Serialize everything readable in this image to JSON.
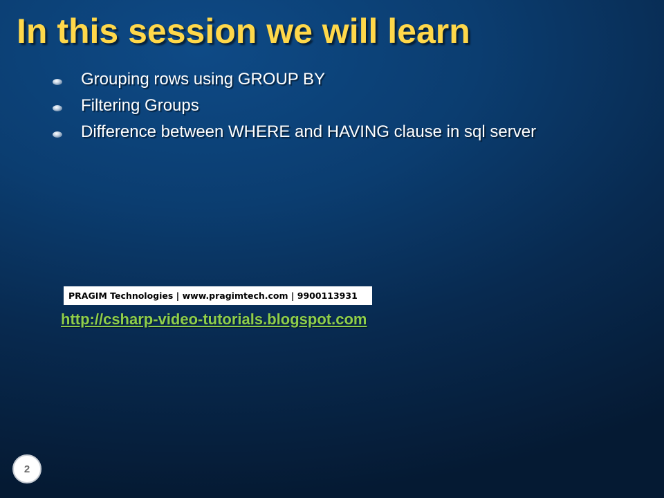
{
  "slide": {
    "title": "In this session we will learn",
    "bullets": [
      {
        "text": "Grouping rows using GROUP BY"
      },
      {
        "text": "Filtering Groups"
      },
      {
        "text": "Difference between WHERE and HAVING clause in sql server"
      }
    ],
    "company_banner": "PRAGIM Technologies | www.pragimtech.com | 9900113931",
    "blog_link": "http://csharp-video-tutorials.blogspot.com",
    "page_number": "2"
  },
  "colors": {
    "title": "#ffd84a",
    "bullet_text": "#ffffff",
    "link": "#8fcf4a",
    "background_top": "#0e4a86",
    "background_bottom": "#051a33"
  },
  "icons": {
    "bullet": "bullet-dot-icon"
  }
}
